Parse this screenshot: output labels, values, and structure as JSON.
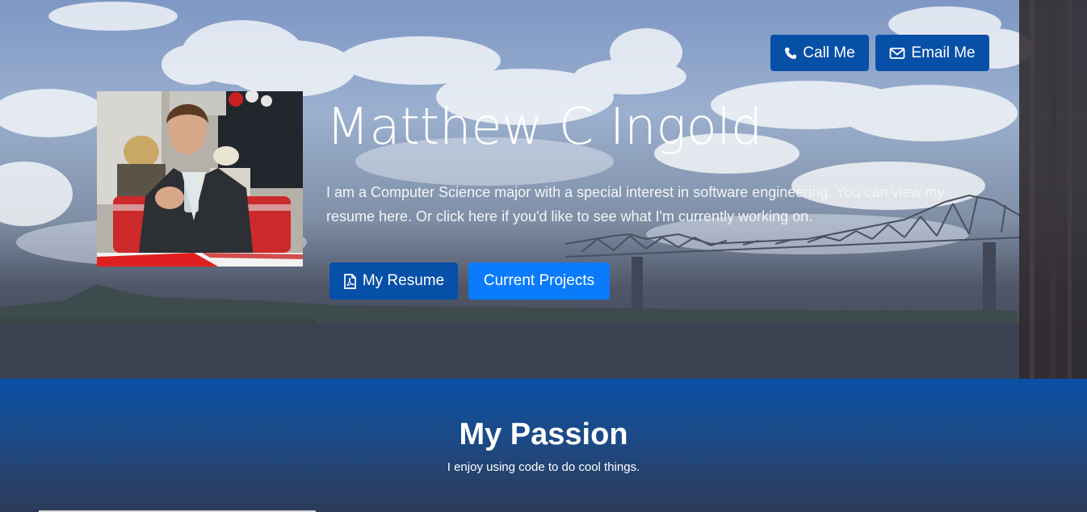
{
  "hero": {
    "name": "Matthew C Ingold",
    "intro": "I am a Computer Science major with a special interest in software engineering. You can view my resume here. Or click here if you'd like to see what I'm currently working on.",
    "photo_icon": "profile-photo"
  },
  "contact": {
    "call_label": "Call Me",
    "call_icon": "phone-icon",
    "email_label": "Email Me",
    "email_icon": "envelope-icon"
  },
  "actions": {
    "resume_label": "My Resume",
    "resume_icon": "pdf-file-icon",
    "projects_label": "Current Projects"
  },
  "passion": {
    "title": "My Passion",
    "text": "I enjoy using code to do cool things."
  },
  "colors": {
    "primary_dark": "#0750a8",
    "primary_bright": "#0a7bfa",
    "section_blue": "#0a4fa4"
  }
}
